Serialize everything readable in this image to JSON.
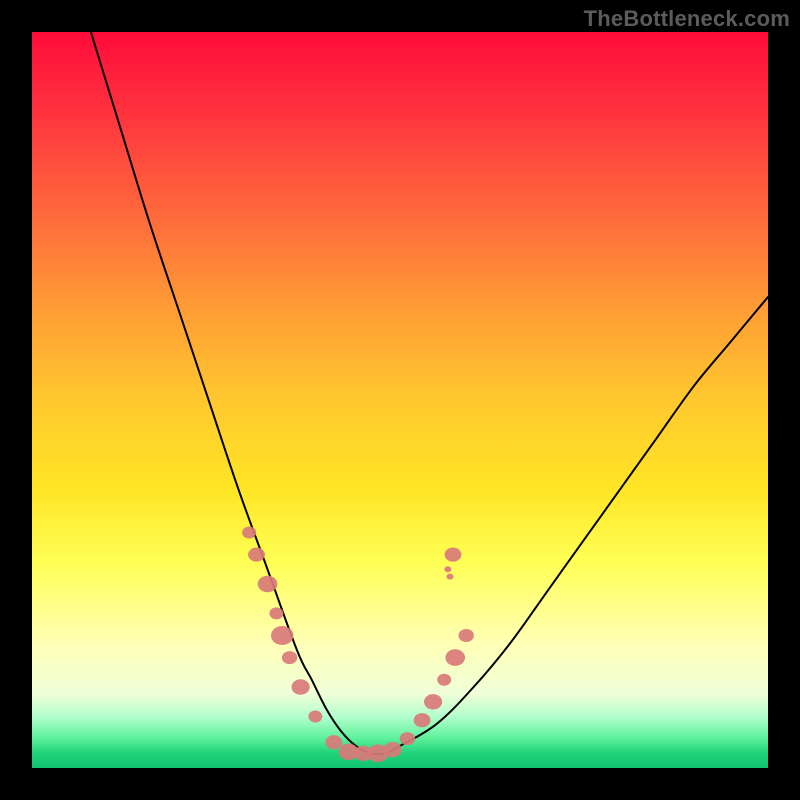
{
  "watermark": {
    "text": "TheBottleneck.com"
  },
  "chart_data": {
    "type": "line",
    "title": "",
    "xlabel": "",
    "ylabel": "",
    "xlim": [
      0,
      100
    ],
    "ylim": [
      0,
      100
    ],
    "grid": false,
    "legend": false,
    "series": [
      {
        "name": "bottleneck-curve",
        "x": [
          8,
          12,
          16,
          20,
          24,
          28,
          32,
          36,
          38,
          40,
          42,
          44,
          46,
          48,
          50,
          55,
          60,
          65,
          70,
          75,
          80,
          85,
          90,
          95,
          100
        ],
        "y": [
          100,
          87,
          74,
          62,
          50,
          38,
          27,
          16,
          12,
          8,
          5,
          3,
          2,
          2,
          3,
          6,
          11,
          17,
          24,
          31,
          38,
          45,
          52,
          58,
          64
        ]
      }
    ],
    "markers": {
      "name": "highlighted-points",
      "color": "#d97a7a",
      "points": [
        {
          "x": 29.5,
          "y": 32,
          "r": 1.0
        },
        {
          "x": 30.5,
          "y": 29,
          "r": 1.2
        },
        {
          "x": 32.0,
          "y": 25,
          "r": 1.4
        },
        {
          "x": 33.2,
          "y": 21,
          "r": 1.0
        },
        {
          "x": 34.0,
          "y": 18,
          "r": 1.6
        },
        {
          "x": 35.0,
          "y": 15,
          "r": 1.1
        },
        {
          "x": 36.5,
          "y": 11,
          "r": 1.3
        },
        {
          "x": 38.5,
          "y": 7,
          "r": 1.0
        },
        {
          "x": 41.0,
          "y": 3.5,
          "r": 1.2
        },
        {
          "x": 43.0,
          "y": 2.2,
          "r": 1.4
        },
        {
          "x": 45.0,
          "y": 2.0,
          "r": 1.3
        },
        {
          "x": 47.0,
          "y": 2.0,
          "r": 1.5
        },
        {
          "x": 49.0,
          "y": 2.5,
          "r": 1.3
        },
        {
          "x": 51.0,
          "y": 4.0,
          "r": 1.1
        },
        {
          "x": 53.0,
          "y": 6.5,
          "r": 1.2
        },
        {
          "x": 54.5,
          "y": 9.0,
          "r": 1.3
        },
        {
          "x": 56.0,
          "y": 12,
          "r": 1.0
        },
        {
          "x": 57.5,
          "y": 15,
          "r": 1.4
        },
        {
          "x": 59.0,
          "y": 18,
          "r": 1.1
        },
        {
          "x": 56.5,
          "y": 27,
          "r": 0.5
        },
        {
          "x": 56.8,
          "y": 26,
          "r": 0.5
        },
        {
          "x": 57.2,
          "y": 29,
          "r": 1.2
        }
      ]
    },
    "gradient_stops": [
      {
        "pos": 0,
        "color": "#ff0b3a"
      },
      {
        "pos": 50,
        "color": "#ffc82e"
      },
      {
        "pos": 83,
        "color": "#ffffb5"
      },
      {
        "pos": 100,
        "color": "#12c36f"
      }
    ]
  }
}
